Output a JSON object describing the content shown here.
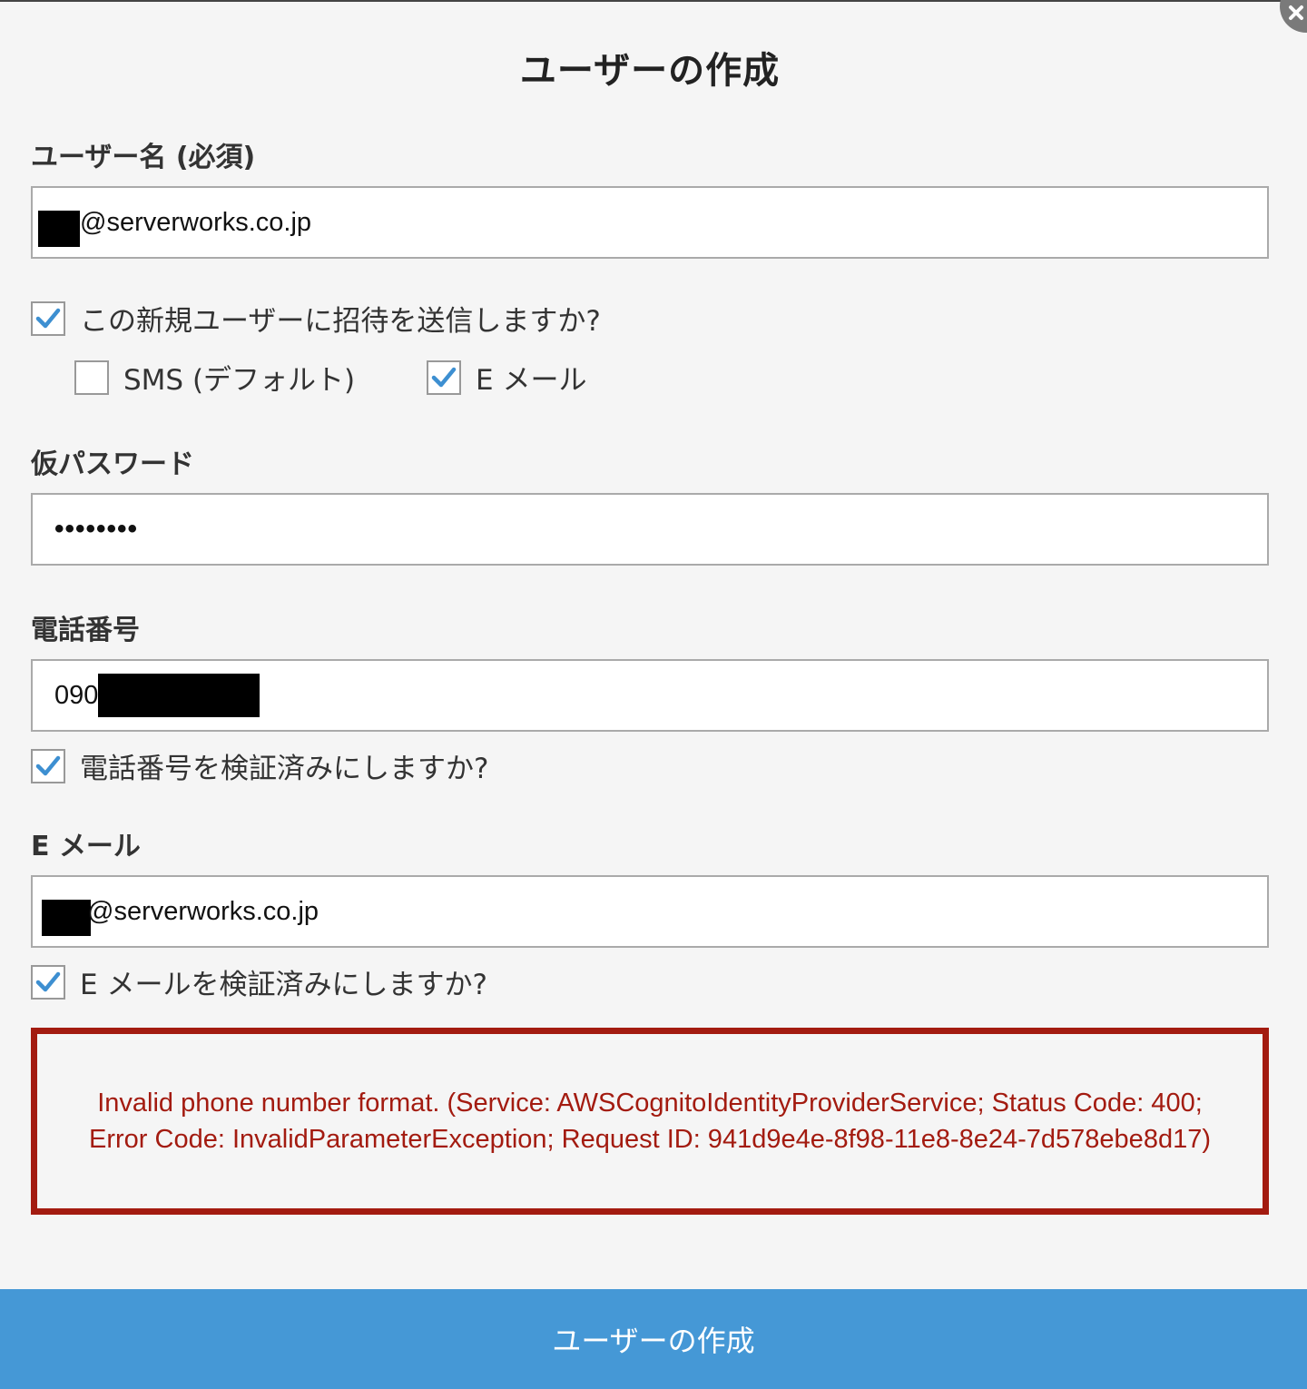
{
  "dialog": {
    "title": "ユーザーの作成",
    "submit_label": "ユーザーの作成"
  },
  "username": {
    "label": "ユーザー名 (必須)",
    "value": "@serverworks.co.jp"
  },
  "invite": {
    "label": "この新規ユーザーに招待を送信しますか?",
    "checked": true,
    "sms_label": "SMS (デフォルト)",
    "sms_checked": false,
    "email_label": "E メール",
    "email_checked": true
  },
  "temp_password": {
    "label": "仮パスワード",
    "value": "••••••••"
  },
  "phone": {
    "label": "電話番号",
    "value": "090",
    "verify_label": "電話番号を検証済みにしますか?",
    "verify_checked": true
  },
  "email": {
    "label": "E メール",
    "value": "@serverworks.co.jp",
    "verify_label": "E メールを検証済みにしますか?",
    "verify_checked": true
  },
  "error": {
    "message": "Invalid phone number format. (Service: AWSCognitoIdentityProviderService; Status Code: 400; Error Code: InvalidParameterException; Request ID: 941d9e4e-8f98-11e8-8e24-7d578ebe8d17)"
  },
  "colors": {
    "accent": "#4598d6",
    "check": "#3d8fd1",
    "error": "#a31b10",
    "background": "#f5f5f5"
  },
  "icons": {
    "close": "close-icon",
    "check": "checkmark-icon"
  }
}
